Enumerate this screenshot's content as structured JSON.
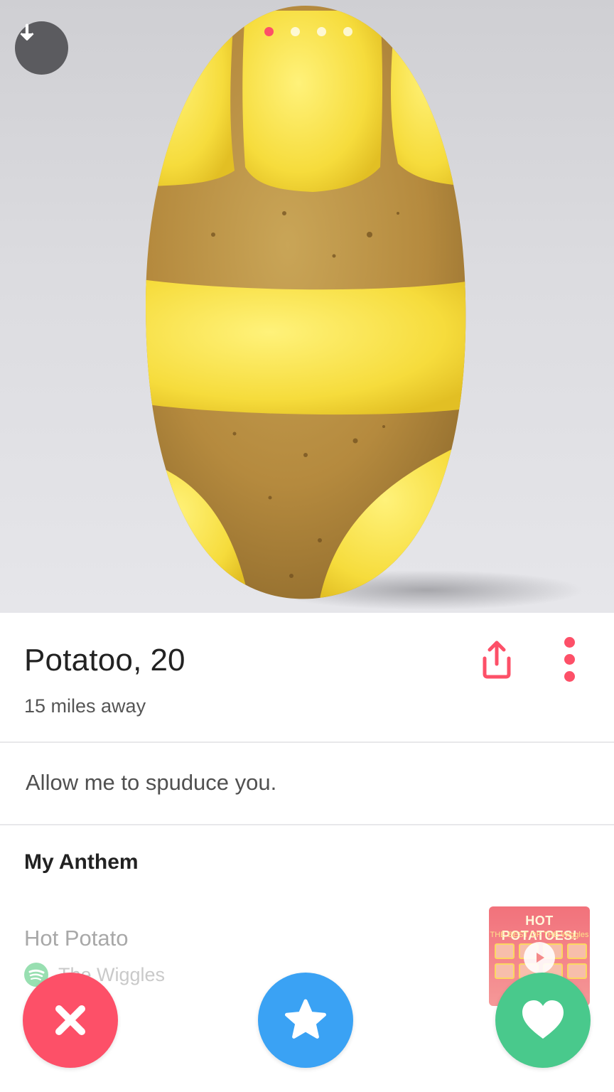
{
  "photo": {
    "subject": "potato-bikini-photo",
    "page_count": 4,
    "active_index": 0
  },
  "profile": {
    "name": "Potatoo",
    "age_text": ", 20",
    "distance": "15 miles away",
    "bio": "Allow me to spuduce you."
  },
  "anthem": {
    "section_title": "My Anthem",
    "song": "Hot Potato",
    "artist": "The Wiggles",
    "album_title": "HOT POTATOES!",
    "album_subtitle": "THE BEST OF THE Wiggles"
  },
  "colors": {
    "accent": "#fd5068",
    "nope": "#fd5068",
    "super_like": "#3aa2f4",
    "like": "#49c98c",
    "spotify": "#1db954"
  },
  "icons": {
    "download": "down-arrow-icon",
    "share": "share-icon",
    "more": "more-vertical-icon",
    "nope": "close-icon",
    "super_like": "star-icon",
    "like": "heart-icon",
    "spotify": "spotify-icon",
    "play": "play-icon"
  }
}
